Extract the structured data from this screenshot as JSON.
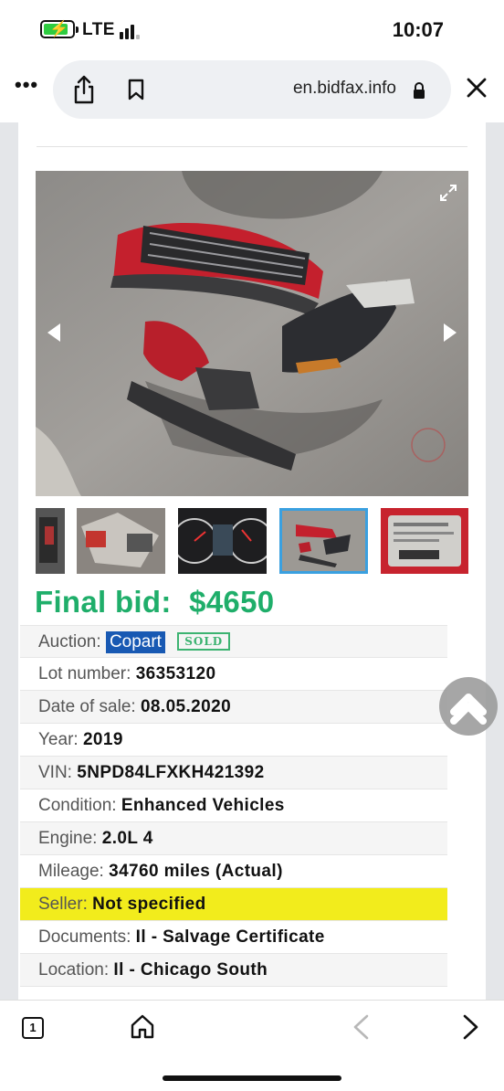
{
  "status_bar": {
    "network": "LTE",
    "time": "10:07",
    "battery_level": 0.85
  },
  "browser": {
    "url": "en.bidfax.info"
  },
  "listing": {
    "final_bid_label": "Final bid:",
    "final_bid_value": "$4650",
    "auction_label": "Auction:",
    "auction_value": "Copart",
    "sold_badge": "SOLD",
    "specs": [
      {
        "label": "Lot number:",
        "value": "36353120"
      },
      {
        "label": "Date of sale:",
        "value": "08.05.2020"
      },
      {
        "label": "Year:",
        "value": "2019"
      },
      {
        "label": "VIN:",
        "value": "5NPD84LFXKH421392"
      },
      {
        "label": "Condition:",
        "value": "Enhanced Vehicles"
      },
      {
        "label": "Engine:",
        "value": "2.0L 4"
      },
      {
        "label": "Mileage:",
        "value": "34760 miles (Actual)"
      },
      {
        "label": "Seller:",
        "value": "Not specified"
      },
      {
        "label": "Documents:",
        "value": "Il - Salvage Certificate"
      },
      {
        "label": "Location:",
        "value": "Il - Chicago South"
      }
    ]
  },
  "bottom_bar": {
    "tab_count": "1"
  },
  "colors": {
    "final_bid": "#1fae6a",
    "auction_tag": "#1859b3",
    "seller_highlight": "#f2ec1c",
    "active_thumb_border": "#3aa0e0"
  }
}
